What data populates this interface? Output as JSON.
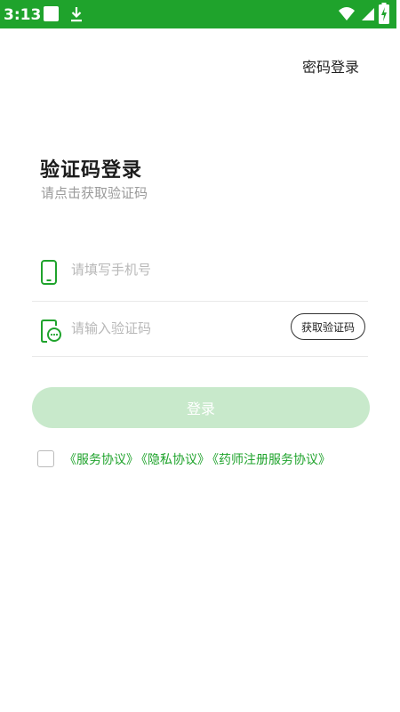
{
  "status_bar": {
    "time": "3:13",
    "color": "#1fa32c"
  },
  "header": {
    "password_login": "密码登录"
  },
  "main": {
    "title": "验证码登录",
    "subtitle": "请点击获取验证码",
    "phone_field": {
      "placeholder": "请填写手机号",
      "icon": "phone-icon"
    },
    "code_field": {
      "placeholder": "请输入验证码",
      "icon": "sms-code-icon"
    },
    "get_code_label": "获取验证码",
    "login_label": "登录",
    "accent_color": "#1fa32c",
    "disabled_button_color": "#c8e9cb"
  },
  "agreement": {
    "checked": false,
    "links": [
      "《服务协议》",
      "《隐私协议》",
      "《药师注册服务协议》"
    ]
  }
}
